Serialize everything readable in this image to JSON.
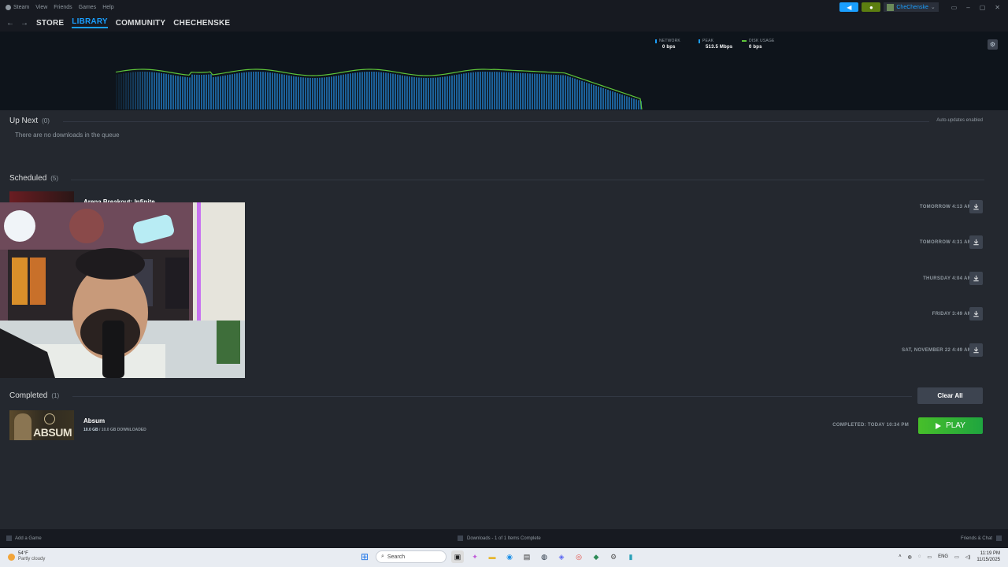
{
  "menubar": {
    "items": [
      "Steam",
      "View",
      "Friends",
      "Games",
      "Help"
    ]
  },
  "titlebar": {
    "username": "CheChenske"
  },
  "nav": {
    "tabs": [
      "STORE",
      "LIBRARY",
      "COMMUNITY",
      "CHECHENSKE"
    ],
    "active": "LIBRARY"
  },
  "graph": {
    "legend": [
      {
        "label": "NETWORK",
        "value": "0 bps",
        "color": "#1a9fff"
      },
      {
        "label": "PEAK",
        "value": "513.5 Mbps",
        "color": "#1a9fff"
      },
      {
        "label": "DISK USAGE",
        "value": "0 bps",
        "color": "#5ec53a"
      }
    ]
  },
  "up_next": {
    "title": "Up Next",
    "count": "(0)",
    "empty": "There are no downloads in the queue",
    "auto_updates": "Auto-updates enabled"
  },
  "scheduled": {
    "title": "Scheduled",
    "count": "(5)",
    "first_game": "Arena Breakout: Infinite",
    "times": [
      "TOMORROW 4:13 AM",
      "TOMORROW 4:31 AM",
      "THURSDAY 4:04 AM",
      "FRIDAY 3:49 AM",
      "SAT, NOVEMBER 22 4:49 AM"
    ]
  },
  "completed": {
    "title": "Completed",
    "count": "(1)",
    "clear_label": "Clear All",
    "game": "Absum",
    "thumb_text": "ABSUM",
    "size_done": "10.0 GB",
    "size_total": "/ 10.0 GB DOWNLOADED",
    "time": "COMPLETED: TODAY 10:34 PM",
    "play_label": "PLAY"
  },
  "statusbar": {
    "add_game": "Add a Game",
    "downloads": "Downloads - 1 of 1 Items Complete",
    "friends": "Friends & Chat"
  },
  "taskbar": {
    "temp": "54°F",
    "weather": "Partly cloudy",
    "search": "Search",
    "lang": "ENG",
    "time": "11:19 PM",
    "date": "11/15/2025"
  },
  "colors": {
    "accent": "#1a9fff",
    "play": "#47bf2a",
    "bg": "#24282f"
  }
}
